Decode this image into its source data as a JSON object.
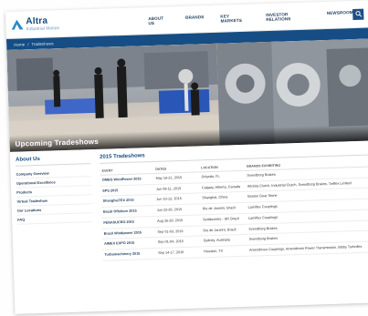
{
  "header": {
    "brand": "Altra",
    "tagline": "Industrial Motion",
    "nav": [
      "ABOUT US",
      "BRANDS",
      "KEY MARKETS",
      "INVESTOR RELATIONS",
      "NEWSROOM"
    ]
  },
  "breadcrumb": {
    "home": "Home",
    "separator": "/",
    "current": "Tradeshows"
  },
  "hero": {
    "title": "Upcoming Tradeshows"
  },
  "sidebar": {
    "title": "About Us",
    "items": [
      "Company Overview",
      "Operational Excellence",
      "Products",
      "Virtual Tradeshow",
      "Our Locations",
      "FAQ"
    ]
  },
  "main": {
    "title": "2015 Tradeshows",
    "columns": [
      "EVENT",
      "DATES",
      "LOCATION",
      "BRANDS EXHIBITING"
    ],
    "rows": [
      [
        "OMEG WindPower 2015",
        "May 18-21, 2015",
        "Orlando, FL",
        "Svendborg Brakes"
      ],
      [
        "SPS 2015",
        "Jun 09-11, 2015",
        "Calgary, Alberta, Canada",
        "Wichita Clutch, Industrial Clutch, Svendborg Brakes, Twiflex Limited"
      ],
      [
        "ShanghaiTEX 2015",
        "Jun 10-12, 2015",
        "Shanghai, China",
        "Boston Gear Stone"
      ],
      [
        "Brazil Offshore 2015",
        "Jun 23-26, 2015",
        "Rio de Janeiro, Brazil",
        "Lamiflex Couplings"
      ],
      [
        "FENASUCRO 2015",
        "Aug 25-28, 2015",
        "Sertãozinho - SP, Brazil",
        "Lamiflex Couplings"
      ],
      [
        "Brazil Windpower 2015",
        "Sep 01-03, 2015",
        "Rio de Janeiro, Brazil",
        "Svendborg Brakes"
      ],
      [
        "AIMEX EXPO 2015",
        "Sep 01-04, 2015",
        "Sydney, Australia",
        "Svendborg Brakes"
      ],
      [
        "Turbomachinery 2015",
        "Sep 14-17, 2015",
        "Houston, TX",
        "Ameridrives Couplings, Ameridrives Power Transmission, Bibby Turboflex"
      ]
    ]
  },
  "colors": {
    "primary": "#154d84",
    "brand_text": "#114a7f",
    "tagline": "#6a9ec7"
  }
}
